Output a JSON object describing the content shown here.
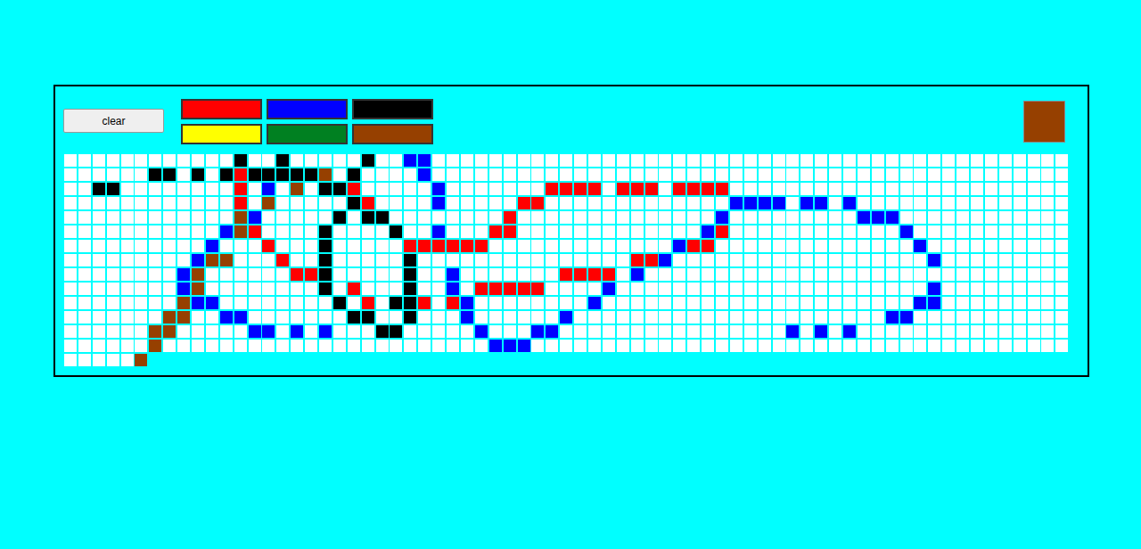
{
  "toolbar": {
    "clear_button": "clear"
  },
  "palette": [
    {
      "key": "r",
      "color": "#ff0000",
      "selected": false
    },
    {
      "key": "b",
      "color": "#0000ff",
      "selected": false
    },
    {
      "key": "k",
      "color": "#000000",
      "selected": false
    },
    {
      "key": "y",
      "color": "#ffff00",
      "selected": false
    },
    {
      "key": "g",
      "color": "#008021",
      "selected": false
    },
    {
      "key": "n",
      "color": "#964000",
      "selected": true
    }
  ],
  "canvas": {
    "empty_color": "#ffffff",
    "rows": [
      [
        "..........",
        "..k..k....",
        ".k..bb....",
        "..........",
        "..........",
        "..........",
        "..........",
        "."
      ],
      [
        "......kk.k",
        ".krkkkkkn.",
        "k....b....",
        "..........",
        "..........",
        "..........",
        "..........",
        "."
      ],
      [
        "..kk......",
        "..r.b.n.kk",
        "r.....b...",
        "....rrrr.r",
        "rr.rrrr...",
        "..........",
        "..........",
        "."
      ],
      [
        "..........",
        "..r.n.....",
        "kr....b...",
        "..rr......",
        ".......bbb",
        "b.bb.b....",
        "..........",
        "."
      ],
      [
        "..........",
        "..nb.....k",
        ".kk.......",
        ".r........",
        "......b...",
        "......bbb.",
        "..........",
        "."
      ],
      [
        "..........",
        ".bnr....k.",
        "...k..b...",
        "rr........",
        ".....br...",
        ".........b",
        "..........",
        "."
      ],
      [
        "..........",
        "b...r...k.",
        "....rrrrrr",
        "..........",
        "...brr....",
        "..........",
        "b.........",
        "."
      ],
      [
        ".........b",
        "nn...r..k.",
        "....k.....",
        "..........",
        "rrb.......",
        "..........",
        ".b........",
        "."
      ],
      [
        "........bn",
        "......rrk.",
        "....k..b..",
        ".....rrrr.",
        "b.........",
        "..........",
        "..........",
        "."
      ],
      [
        "........bn",
        "........k.",
        "r...k..b.r",
        "rrrr....b.",
        "..........",
        "..........",
        ".b........",
        "."
      ],
      [
        "........nb",
        "b........k",
        ".r.kkr.rb.",
        ".......b..",
        "..........",
        "..........",
        "bb........",
        "."
      ],
      [
        ".......nn.",
        ".bb.......",
        "kk..k...b.",
        ".....b....",
        "..........",
        "........bb",
        "..........",
        "."
      ],
      [
        "......nn..",
        "...bb.b.b.",
        "..kk.....b",
        "...bb.....",
        "..........",
        ".b.b.b....",
        "..........",
        "."
      ],
      [
        "......n...",
        "..........",
        "..........",
        "bbb.......",
        "..........",
        "..........",
        "..........",
        "."
      ],
      [
        ".....n"
      ]
    ]
  }
}
